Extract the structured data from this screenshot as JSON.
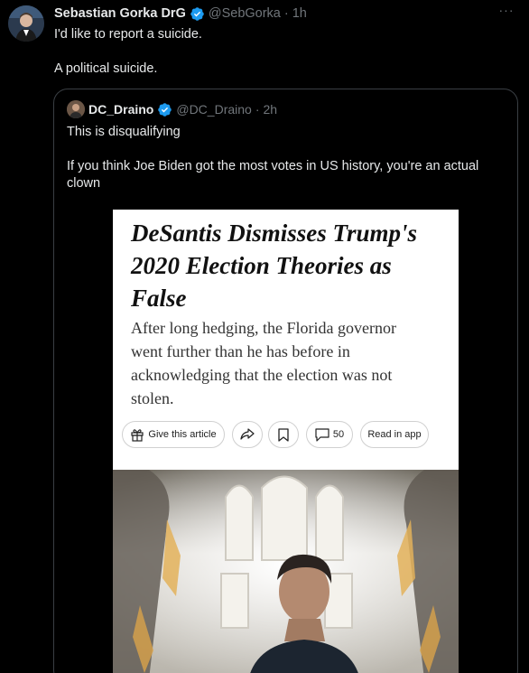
{
  "tweet": {
    "author_name": "Sebastian Gorka DrG",
    "handle": "@SebGorka",
    "separator": "·",
    "time": "1h",
    "text_lines": [
      "I'd like to report a suicide.",
      "A political suicide."
    ],
    "more_icon": "more-horizontal-icon",
    "verified_color": "#1d9bf0"
  },
  "quote": {
    "author_name": "DC_Draino",
    "handle": "@DC_Draino",
    "separator": "·",
    "time": "2h",
    "text_lines": [
      "This is disqualifying",
      "If you think Joe Biden got the most votes in US history, you're an actual clown"
    ]
  },
  "article": {
    "headline": "DeSantis Dismisses Trump's 2020 Election Theories as False",
    "dek": "After long hedging, the Florida governor went further than he has before in acknowledging that the election was not stolen.",
    "actions": {
      "give_label": "Give this article",
      "comment_count": "50",
      "read_in_app": "Read in app"
    }
  }
}
